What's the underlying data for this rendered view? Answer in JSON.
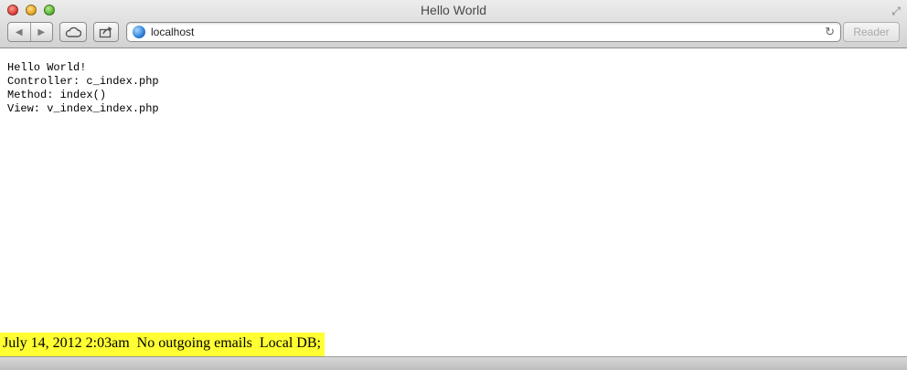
{
  "window": {
    "title": "Hello World"
  },
  "toolbar": {
    "back_icon": "left-triangle",
    "forward_icon": "right-triangle",
    "cloud_icon": "icloud-tabs",
    "share_icon": "share-arrow",
    "address": {
      "url": "localhost",
      "icon": "globe"
    },
    "reload_icon": "reload-arrow",
    "reader_label": "Reader"
  },
  "page": {
    "lines": [
      "Hello World!",
      "Controller: c_index.php",
      "Method: index()",
      "View: v_index_index.php"
    ],
    "footer": {
      "text": "July 14, 2012 2:03am  No outgoing emails  Local DB;",
      "background": "#ffff33"
    }
  }
}
